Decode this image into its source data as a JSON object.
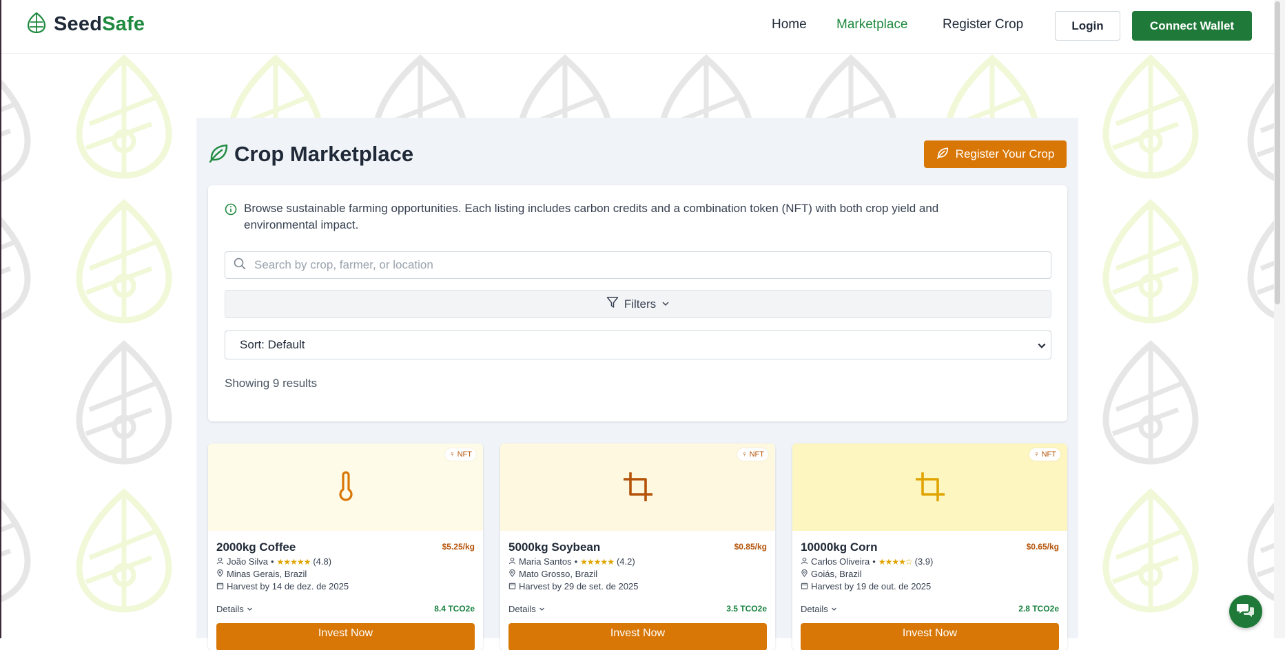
{
  "brand": {
    "name_part1": "Seed",
    "name_part2": "Safe",
    "logo_icon": "leaf-globe-icon"
  },
  "nav": {
    "links": [
      {
        "label": "Home",
        "active": false
      },
      {
        "label": "Marketplace",
        "active": true
      },
      {
        "label": "Register Crop",
        "active": false
      }
    ],
    "login_label": "Login",
    "wallet_label": "Connect Wallet"
  },
  "main": {
    "title": "Crop Marketplace",
    "title_icon": "leaf-icon",
    "register_label": "Register Your Crop",
    "info_text": "Browse sustainable farming opportunities. Each listing includes carbon credits and a combination token (NFT) with both crop yield and environmental impact.",
    "search_placeholder": "Search by crop, farmer, or location",
    "filters_label": "Filters",
    "sort_label": "Sort: Default",
    "results_text": "Showing 9 results"
  },
  "listings": [
    {
      "title": "2000kg Coffee",
      "price": "$5.25/kg",
      "farmer": "João Silva",
      "rating": "(4.8)",
      "stars": "★★★★★",
      "location": "Minas Gerais, Brazil",
      "harvest": "Harvest by 14 de dez. de 2025",
      "carbon": "8.4 TCO2e",
      "icon": "thermometer-icon",
      "bg": "#fefbe8",
      "icon_color": "#d97706",
      "badge": "NFT",
      "details": "Details",
      "invest": "Invest Now"
    },
    {
      "title": "5000kg Soybean",
      "price": "$0.85/kg",
      "farmer": "Maria Santos",
      "rating": "(4.2)",
      "stars": "★★★★★",
      "location": "Mato Grosso, Brazil",
      "harvest": "Harvest by 29 de set. de 2025",
      "carbon": "3.5 TCO2e",
      "icon": "crop-icon",
      "bg": "#fdf8df",
      "icon_color": "#b45309",
      "badge": "NFT",
      "details": "Details",
      "invest": "Invest Now"
    },
    {
      "title": "10000kg Corn",
      "price": "$0.65/kg",
      "farmer": "Carlos Oliveira",
      "rating": "(3.9)",
      "stars": "★★★★☆",
      "location": "Goiás, Brazil",
      "harvest": "Harvest by 19 de out. de 2025",
      "carbon": "2.8 TCO2e",
      "icon": "crop-icon",
      "bg": "#fef6c1",
      "icon_color": "#e0a400",
      "badge": "NFT",
      "details": "Details",
      "invest": "Invest Now"
    }
  ],
  "colors": {
    "brand_green": "#1f8a3f",
    "accent_orange": "#d97706",
    "panel_bg": "#f0f4f8"
  },
  "chat_icon": "chat-bubbles-icon"
}
